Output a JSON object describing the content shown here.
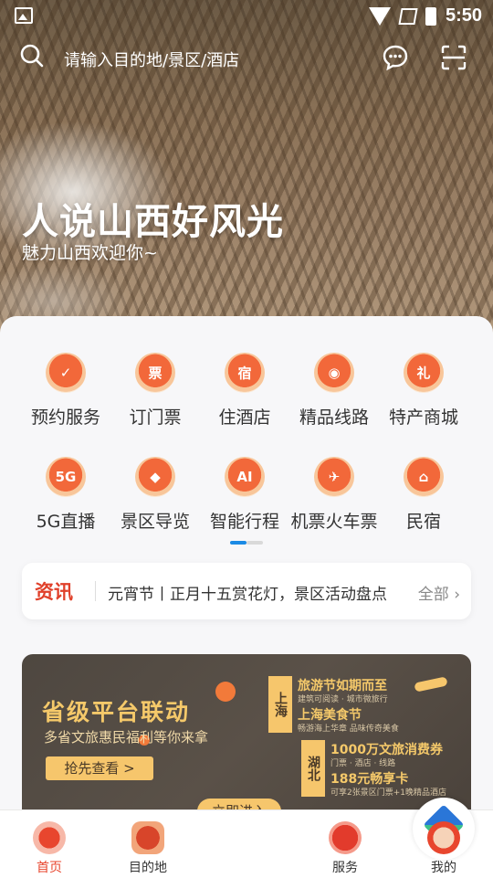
{
  "status_bar": {
    "time": "5:50"
  },
  "search": {
    "placeholder": "请输入目的地/景区/酒店"
  },
  "hero": {
    "title": "人说山西好风光",
    "subtitle": "魅力山西欢迎你~"
  },
  "grid": {
    "items": [
      {
        "label": "预约服务",
        "glyph": "✓"
      },
      {
        "label": "订门票",
        "glyph": "票"
      },
      {
        "label": "住酒店",
        "glyph": "宿"
      },
      {
        "label": "精品线路",
        "glyph": "◉"
      },
      {
        "label": "特产商城",
        "glyph": "礼"
      },
      {
        "label": "5G直播",
        "glyph": "5G"
      },
      {
        "label": "景区导览",
        "glyph": "◆"
      },
      {
        "label": "智能行程",
        "glyph": "AI"
      },
      {
        "label": "机票火车票",
        "glyph": "✈"
      },
      {
        "label": "民宿",
        "glyph": "⌂"
      }
    ]
  },
  "news": {
    "tag": "资讯",
    "text": "元宵节丨正月十五赏花灯，景区活动盘点",
    "all": "全部"
  },
  "banner": {
    "title": "省级平台联动",
    "subtitle": "多省文旅惠民福利等你来拿",
    "button": "抢先查看 >",
    "card1_side": "上海",
    "card1_line1": "旅游节如期而至",
    "card1_line1_sub": "建筑可阅读 · 城市微旅行",
    "card1_line2": "上海美食节",
    "card1_line2_sub": "畅游海上华章 品味传奇美食",
    "card2_side": "湖北",
    "card2_line1": "1000万文旅消费券",
    "card2_line1_sub": "门票 · 酒店 · 线路",
    "card2_line2": "188元畅享卡",
    "card2_line2_sub": "可享2张景区门票+1晚精品酒店",
    "cta": "立即进入"
  },
  "tabbar": {
    "items": [
      {
        "label": "首页",
        "active": true
      },
      {
        "label": "目的地"
      },
      {
        "label": ""
      },
      {
        "label": "服务"
      },
      {
        "label": "我的"
      }
    ]
  },
  "colors": {
    "accent": "#e8462e",
    "pager_active": "#1a8ae5",
    "banner_gold": "#f6c66c"
  }
}
